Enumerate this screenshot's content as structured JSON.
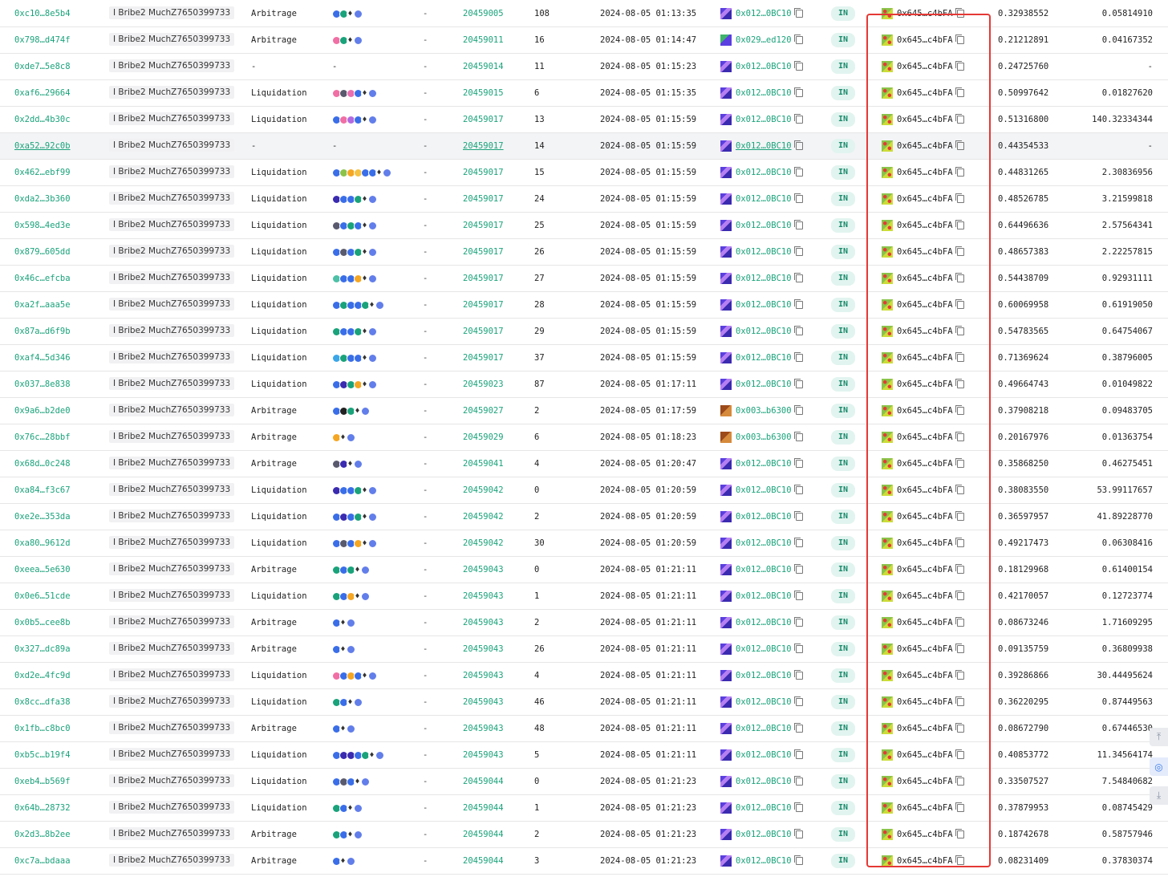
{
  "colors": {
    "link": "#1aa37a",
    "highlight": "#e53935",
    "badge_bg": "#e2f4ef",
    "badge_fg": "#1a8a6b"
  },
  "icons": {
    "eth": "♦",
    "scroll_top": "⤒",
    "target": "◎",
    "scroll_bottom": "⤓"
  },
  "rows": [
    {
      "hash": "0xc10…8e5b4",
      "bribe": "I Bribe2 MuchZ7650399733",
      "type": "Arbitrage",
      "tokens": [
        "#3a6ee8",
        "#1aa37a"
      ],
      "dash": "-",
      "block": "20459005",
      "pos": "108",
      "time": "2024-08-05 01:13:35",
      "builder": "0x012…0BC10",
      "bicon": "purple",
      "dir": "IN",
      "to": "0x645…c4bFA",
      "v1": "0.32938552",
      "v2": "0.05814910"
    },
    {
      "hash": "0x798…d474f",
      "bribe": "I Bribe2 MuchZ7650399733",
      "type": "Arbitrage",
      "tokens": [
        "#f06fa4",
        "#1aa37a"
      ],
      "dash": "-",
      "block": "20459011",
      "pos": "16",
      "time": "2024-08-05 01:14:47",
      "builder": "0x029…ed120",
      "bicon": "green",
      "dir": "IN",
      "to": "0x645…c4bFA",
      "v1": "0.21212891",
      "v2": "0.04167352"
    },
    {
      "hash": "0xde7…5e8c8",
      "bribe": "I Bribe2 MuchZ7650399733",
      "type": "-",
      "tokens": [],
      "tokdash": "-",
      "dash": "-",
      "block": "20459014",
      "pos": "11",
      "time": "2024-08-05 01:15:23",
      "builder": "0x012…0BC10",
      "bicon": "purple",
      "dir": "IN",
      "to": "0x645…c4bFA",
      "v1": "0.24725760",
      "v2": "-"
    },
    {
      "hash": "0xaf6…29664",
      "bribe": "I Bribe2 MuchZ7650399733",
      "type": "Liquidation",
      "tokens": [
        "#f06fa4",
        "#5a5a6e",
        "#e86fb0",
        "#3a6ee8"
      ],
      "dash": "-",
      "block": "20459015",
      "pos": "6",
      "time": "2024-08-05 01:15:35",
      "builder": "0x012…0BC10",
      "bicon": "purple",
      "dir": "IN",
      "to": "0x645…c4bFA",
      "v1": "0.50997642",
      "v2": "0.01827620"
    },
    {
      "hash": "0x2dd…4b30c",
      "bribe": "I Bribe2 MuchZ7650399733",
      "type": "Liquidation",
      "tokens": [
        "#3a6ee8",
        "#f06fa4",
        "#b26ae0",
        "#3a6ee8"
      ],
      "dash": "-",
      "block": "20459017",
      "pos": "13",
      "time": "2024-08-05 01:15:59",
      "builder": "0x012…0BC10",
      "bicon": "purple",
      "dir": "IN",
      "to": "0x645…c4bFA",
      "v1": "0.51316800",
      "v2": "140.32334344"
    },
    {
      "hash": "0xa52…92c0b",
      "bribe": "I Bribe2 MuchZ7650399733",
      "type": "-",
      "tokens": [],
      "tokdash": "-",
      "dash": "-",
      "block": "20459017",
      "pos": "14",
      "time": "2024-08-05 01:15:59",
      "builder": "0x012…0BC10",
      "bicon": "purple",
      "dir": "IN",
      "to": "0x645…c4bFA",
      "v1": "0.44354533",
      "v2": "-",
      "hover": true
    },
    {
      "hash": "0x462…ebf99",
      "bribe": "I Bribe2 MuchZ7650399733",
      "type": "Liquidation",
      "tokens": [
        "#3a6ee8",
        "#8bc34a",
        "#f5a623",
        "#f5c242",
        "#3a6ee8",
        "#3a6ee8"
      ],
      "dash": "-",
      "block": "20459017",
      "pos": "15",
      "time": "2024-08-05 01:15:59",
      "builder": "0x012…0BC10",
      "bicon": "purple",
      "dir": "IN",
      "to": "0x645…c4bFA",
      "v1": "0.44831265",
      "v2": "2.30836956"
    },
    {
      "hash": "0xda2…3b360",
      "bribe": "I Bribe2 MuchZ7650399733",
      "type": "Liquidation",
      "tokens": [
        "#3a2bb0",
        "#3a6ee8",
        "#3a6ee8",
        "#1aa37a"
      ],
      "dash": "-",
      "block": "20459017",
      "pos": "24",
      "time": "2024-08-05 01:15:59",
      "builder": "0x012…0BC10",
      "bicon": "purple",
      "dir": "IN",
      "to": "0x645…c4bFA",
      "v1": "0.48526785",
      "v2": "3.21599818"
    },
    {
      "hash": "0x598…4ed3e",
      "bribe": "I Bribe2 MuchZ7650399733",
      "type": "Liquidation",
      "tokens": [
        "#5a5a6e",
        "#3a6ee8",
        "#1aa37a",
        "#3a6ee8"
      ],
      "dash": "-",
      "block": "20459017",
      "pos": "25",
      "time": "2024-08-05 01:15:59",
      "builder": "0x012…0BC10",
      "bicon": "purple",
      "dir": "IN",
      "to": "0x645…c4bFA",
      "v1": "0.64496636",
      "v2": "2.57564341"
    },
    {
      "hash": "0x879…605dd",
      "bribe": "I Bribe2 MuchZ7650399733",
      "type": "Liquidation",
      "tokens": [
        "#3a6ee8",
        "#5a5a6e",
        "#3a6ee8",
        "#1aa37a"
      ],
      "dash": "-",
      "block": "20459017",
      "pos": "26",
      "time": "2024-08-05 01:15:59",
      "builder": "0x012…0BC10",
      "bicon": "purple",
      "dir": "IN",
      "to": "0x645…c4bFA",
      "v1": "0.48657383",
      "v2": "2.22257815"
    },
    {
      "hash": "0x46c…efcba",
      "bribe": "I Bribe2 MuchZ7650399733",
      "type": "Liquidation",
      "tokens": [
        "#4dc0a5",
        "#3a6ee8",
        "#3a6ee8",
        "#f5a623"
      ],
      "dash": "-",
      "block": "20459017",
      "pos": "27",
      "time": "2024-08-05 01:15:59",
      "builder": "0x012…0BC10",
      "bicon": "purple",
      "dir": "IN",
      "to": "0x645…c4bFA",
      "v1": "0.54438709",
      "v2": "0.92931111"
    },
    {
      "hash": "0xa2f…aaa5e",
      "bribe": "I Bribe2 MuchZ7650399733",
      "type": "Liquidation",
      "tokens": [
        "#3a6ee8",
        "#1aa37a",
        "#3a6ee8",
        "#3a6ee8",
        "#1aa37a"
      ],
      "dash": "-",
      "block": "20459017",
      "pos": "28",
      "time": "2024-08-05 01:15:59",
      "builder": "0x012…0BC10",
      "bicon": "purple",
      "dir": "IN",
      "to": "0x645…c4bFA",
      "v1": "0.60069958",
      "v2": "0.61919050"
    },
    {
      "hash": "0x87a…d6f9b",
      "bribe": "I Bribe2 MuchZ7650399733",
      "type": "Liquidation",
      "tokens": [
        "#1aa37a",
        "#3a6ee8",
        "#3a6ee8",
        "#1aa37a"
      ],
      "dash": "-",
      "block": "20459017",
      "pos": "29",
      "time": "2024-08-05 01:15:59",
      "builder": "0x012…0BC10",
      "bicon": "purple",
      "dir": "IN",
      "to": "0x645…c4bFA",
      "v1": "0.54783565",
      "v2": "0.64754067"
    },
    {
      "hash": "0xaf4…5d346",
      "bribe": "I Bribe2 MuchZ7650399733",
      "type": "Liquidation",
      "tokens": [
        "#3aa6e8",
        "#1aa37a",
        "#3a6ee8",
        "#3a6ee8"
      ],
      "dash": "-",
      "block": "20459017",
      "pos": "37",
      "time": "2024-08-05 01:15:59",
      "builder": "0x012…0BC10",
      "bicon": "purple",
      "dir": "IN",
      "to": "0x645…c4bFA",
      "v1": "0.71369624",
      "v2": "0.38796005"
    },
    {
      "hash": "0x037…8e838",
      "bribe": "I Bribe2 MuchZ7650399733",
      "type": "Liquidation",
      "tokens": [
        "#3a6ee8",
        "#3a2bb0",
        "#1aa37a",
        "#f5a623"
      ],
      "dash": "-",
      "block": "20459023",
      "pos": "87",
      "time": "2024-08-05 01:17:11",
      "builder": "0x012…0BC10",
      "bicon": "purple",
      "dir": "IN",
      "to": "0x645…c4bFA",
      "v1": "0.49664743",
      "v2": "0.01049822"
    },
    {
      "hash": "0x9a6…b2de0",
      "bribe": "I Bribe2 MuchZ7650399733",
      "type": "Arbitrage",
      "tokens": [
        "#3a6ee8",
        "#222222",
        "#1aa37a"
      ],
      "dash": "-",
      "block": "20459027",
      "pos": "2",
      "time": "2024-08-05 01:17:59",
      "builder": "0x003…b6300",
      "bicon": "brown",
      "dir": "IN",
      "to": "0x645…c4bFA",
      "v1": "0.37908218",
      "v2": "0.09483705"
    },
    {
      "hash": "0x76c…28bbf",
      "bribe": "I Bribe2 MuchZ7650399733",
      "type": "Arbitrage",
      "tokens": [
        "#f5a623"
      ],
      "dash": "-",
      "block": "20459029",
      "pos": "6",
      "time": "2024-08-05 01:18:23",
      "builder": "0x003…b6300",
      "bicon": "brown",
      "dir": "IN",
      "to": "0x645…c4bFA",
      "v1": "0.20167976",
      "v2": "0.01363754"
    },
    {
      "hash": "0x68d…0c248",
      "bribe": "I Bribe2 MuchZ7650399733",
      "type": "Arbitrage",
      "tokens": [
        "#5a5a6e",
        "#3a2bb0"
      ],
      "dash": "-",
      "block": "20459041",
      "pos": "4",
      "time": "2024-08-05 01:20:47",
      "builder": "0x012…0BC10",
      "bicon": "purple",
      "dir": "IN",
      "to": "0x645…c4bFA",
      "v1": "0.35868250",
      "v2": "0.46275451"
    },
    {
      "hash": "0xa84…f3c67",
      "bribe": "I Bribe2 MuchZ7650399733",
      "type": "Liquidation",
      "tokens": [
        "#3a2bb0",
        "#3a6ee8",
        "#3a6ee8",
        "#1aa37a"
      ],
      "dash": "-",
      "block": "20459042",
      "pos": "0",
      "time": "2024-08-05 01:20:59",
      "builder": "0x012…0BC10",
      "bicon": "purple",
      "dir": "IN",
      "to": "0x645…c4bFA",
      "v1": "0.38083550",
      "v2": "53.99117657"
    },
    {
      "hash": "0xe2e…353da",
      "bribe": "I Bribe2 MuchZ7650399733",
      "type": "Liquidation",
      "tokens": [
        "#3a6ee8",
        "#3a2bb0",
        "#3a6ee8",
        "#1aa37a"
      ],
      "dash": "-",
      "block": "20459042",
      "pos": "2",
      "time": "2024-08-05 01:20:59",
      "builder": "0x012…0BC10",
      "bicon": "purple",
      "dir": "IN",
      "to": "0x645…c4bFA",
      "v1": "0.36597957",
      "v2": "41.89228770"
    },
    {
      "hash": "0xa80…9612d",
      "bribe": "I Bribe2 MuchZ7650399733",
      "type": "Liquidation",
      "tokens": [
        "#3a6ee8",
        "#5a5a6e",
        "#3a6ee8",
        "#f5a623"
      ],
      "dash": "-",
      "block": "20459042",
      "pos": "30",
      "time": "2024-08-05 01:20:59",
      "builder": "0x012…0BC10",
      "bicon": "purple",
      "dir": "IN",
      "to": "0x645…c4bFA",
      "v1": "0.49217473",
      "v2": "0.06308416"
    },
    {
      "hash": "0xeea…5e630",
      "bribe": "I Bribe2 MuchZ7650399733",
      "type": "Arbitrage",
      "tokens": [
        "#1aa37a",
        "#3a6ee8",
        "#1aa37a"
      ],
      "dash": "-",
      "block": "20459043",
      "pos": "0",
      "time": "2024-08-05 01:21:11",
      "builder": "0x012…0BC10",
      "bicon": "purple",
      "dir": "IN",
      "to": "0x645…c4bFA",
      "v1": "0.18129968",
      "v2": "0.61400154"
    },
    {
      "hash": "0x0e6…51cde",
      "bribe": "I Bribe2 MuchZ7650399733",
      "type": "Liquidation",
      "tokens": [
        "#1aa37a",
        "#3a6ee8",
        "#f5a623"
      ],
      "dash": "-",
      "block": "20459043",
      "pos": "1",
      "time": "2024-08-05 01:21:11",
      "builder": "0x012…0BC10",
      "bicon": "purple",
      "dir": "IN",
      "to": "0x645…c4bFA",
      "v1": "0.42170057",
      "v2": "0.12723774"
    },
    {
      "hash": "0x0b5…cee8b",
      "bribe": "I Bribe2 MuchZ7650399733",
      "type": "Arbitrage",
      "tokens": [
        "#3a6ee8"
      ],
      "dash": "-",
      "block": "20459043",
      "pos": "2",
      "time": "2024-08-05 01:21:11",
      "builder": "0x012…0BC10",
      "bicon": "purple",
      "dir": "IN",
      "to": "0x645…c4bFA",
      "v1": "0.08673246",
      "v2": "1.71609295"
    },
    {
      "hash": "0x327…dc89a",
      "bribe": "I Bribe2 MuchZ7650399733",
      "type": "Arbitrage",
      "tokens": [
        "#3a6ee8"
      ],
      "dash": "-",
      "block": "20459043",
      "pos": "26",
      "time": "2024-08-05 01:21:11",
      "builder": "0x012…0BC10",
      "bicon": "purple",
      "dir": "IN",
      "to": "0x645…c4bFA",
      "v1": "0.09135759",
      "v2": "0.36809938"
    },
    {
      "hash": "0xd2e…4fc9d",
      "bribe": "I Bribe2 MuchZ7650399733",
      "type": "Liquidation",
      "tokens": [
        "#f06fa4",
        "#3a6ee8",
        "#f5a623",
        "#3a6ee8"
      ],
      "dash": "-",
      "block": "20459043",
      "pos": "4",
      "time": "2024-08-05 01:21:11",
      "builder": "0x012…0BC10",
      "bicon": "purple",
      "dir": "IN",
      "to": "0x645…c4bFA",
      "v1": "0.39286866",
      "v2": "30.44495624"
    },
    {
      "hash": "0x8cc…dfa38",
      "bribe": "I Bribe2 MuchZ7650399733",
      "type": "Liquidation",
      "tokens": [
        "#1aa37a",
        "#3a6ee8"
      ],
      "dash": "-",
      "block": "20459043",
      "pos": "46",
      "time": "2024-08-05 01:21:11",
      "builder": "0x012…0BC10",
      "bicon": "purple",
      "dir": "IN",
      "to": "0x645…c4bFA",
      "v1": "0.36220295",
      "v2": "0.87449563"
    },
    {
      "hash": "0x1fb…c8bc0",
      "bribe": "I Bribe2 MuchZ7650399733",
      "type": "Arbitrage",
      "tokens": [
        "#3a6ee8"
      ],
      "dash": "-",
      "block": "20459043",
      "pos": "48",
      "time": "2024-08-05 01:21:11",
      "builder": "0x012…0BC10",
      "bicon": "purple",
      "dir": "IN",
      "to": "0x645…c4bFA",
      "v1": "0.08672790",
      "v2": "0.67446530"
    },
    {
      "hash": "0xb5c…b19f4",
      "bribe": "I Bribe2 MuchZ7650399733",
      "type": "Liquidation",
      "tokens": [
        "#3a6ee8",
        "#3a2bb0",
        "#3a2bb0",
        "#3a6ee8",
        "#1aa37a"
      ],
      "dash": "-",
      "block": "20459043",
      "pos": "5",
      "time": "2024-08-05 01:21:11",
      "builder": "0x012…0BC10",
      "bicon": "purple",
      "dir": "IN",
      "to": "0x645…c4bFA",
      "v1": "0.40853772",
      "v2": "11.34564174"
    },
    {
      "hash": "0xeb4…b569f",
      "bribe": "I Bribe2 MuchZ7650399733",
      "type": "Liquidation",
      "tokens": [
        "#3a6ee8",
        "#5a5a6e",
        "#3a6ee8"
      ],
      "dash": "-",
      "block": "20459044",
      "pos": "0",
      "time": "2024-08-05 01:21:23",
      "builder": "0x012…0BC10",
      "bicon": "purple",
      "dir": "IN",
      "to": "0x645…c4bFA",
      "v1": "0.33507527",
      "v2": "7.54840682"
    },
    {
      "hash": "0x64b…28732",
      "bribe": "I Bribe2 MuchZ7650399733",
      "type": "Liquidation",
      "tokens": [
        "#1aa37a",
        "#3a6ee8"
      ],
      "dash": "-",
      "block": "20459044",
      "pos": "1",
      "time": "2024-08-05 01:21:23",
      "builder": "0x012…0BC10",
      "bicon": "purple",
      "dir": "IN",
      "to": "0x645…c4bFA",
      "v1": "0.37879953",
      "v2": "0.08745429"
    },
    {
      "hash": "0x2d3…8b2ee",
      "bribe": "I Bribe2 MuchZ7650399733",
      "type": "Arbitrage",
      "tokens": [
        "#1aa37a",
        "#3a6ee8"
      ],
      "dash": "-",
      "block": "20459044",
      "pos": "2",
      "time": "2024-08-05 01:21:23",
      "builder": "0x012…0BC10",
      "bicon": "purple",
      "dir": "IN",
      "to": "0x645…c4bFA",
      "v1": "0.18742678",
      "v2": "0.58757946"
    },
    {
      "hash": "0xc7a…bdaaa",
      "bribe": "I Bribe2 MuchZ7650399733",
      "type": "Arbitrage",
      "tokens": [
        "#3a6ee8"
      ],
      "dash": "-",
      "block": "20459044",
      "pos": "3",
      "time": "2024-08-05 01:21:23",
      "builder": "0x012…0BC10",
      "bicon": "purple",
      "dir": "IN",
      "to": "0x645…c4bFA",
      "v1": "0.08231409",
      "v2": "0.37830374"
    }
  ]
}
